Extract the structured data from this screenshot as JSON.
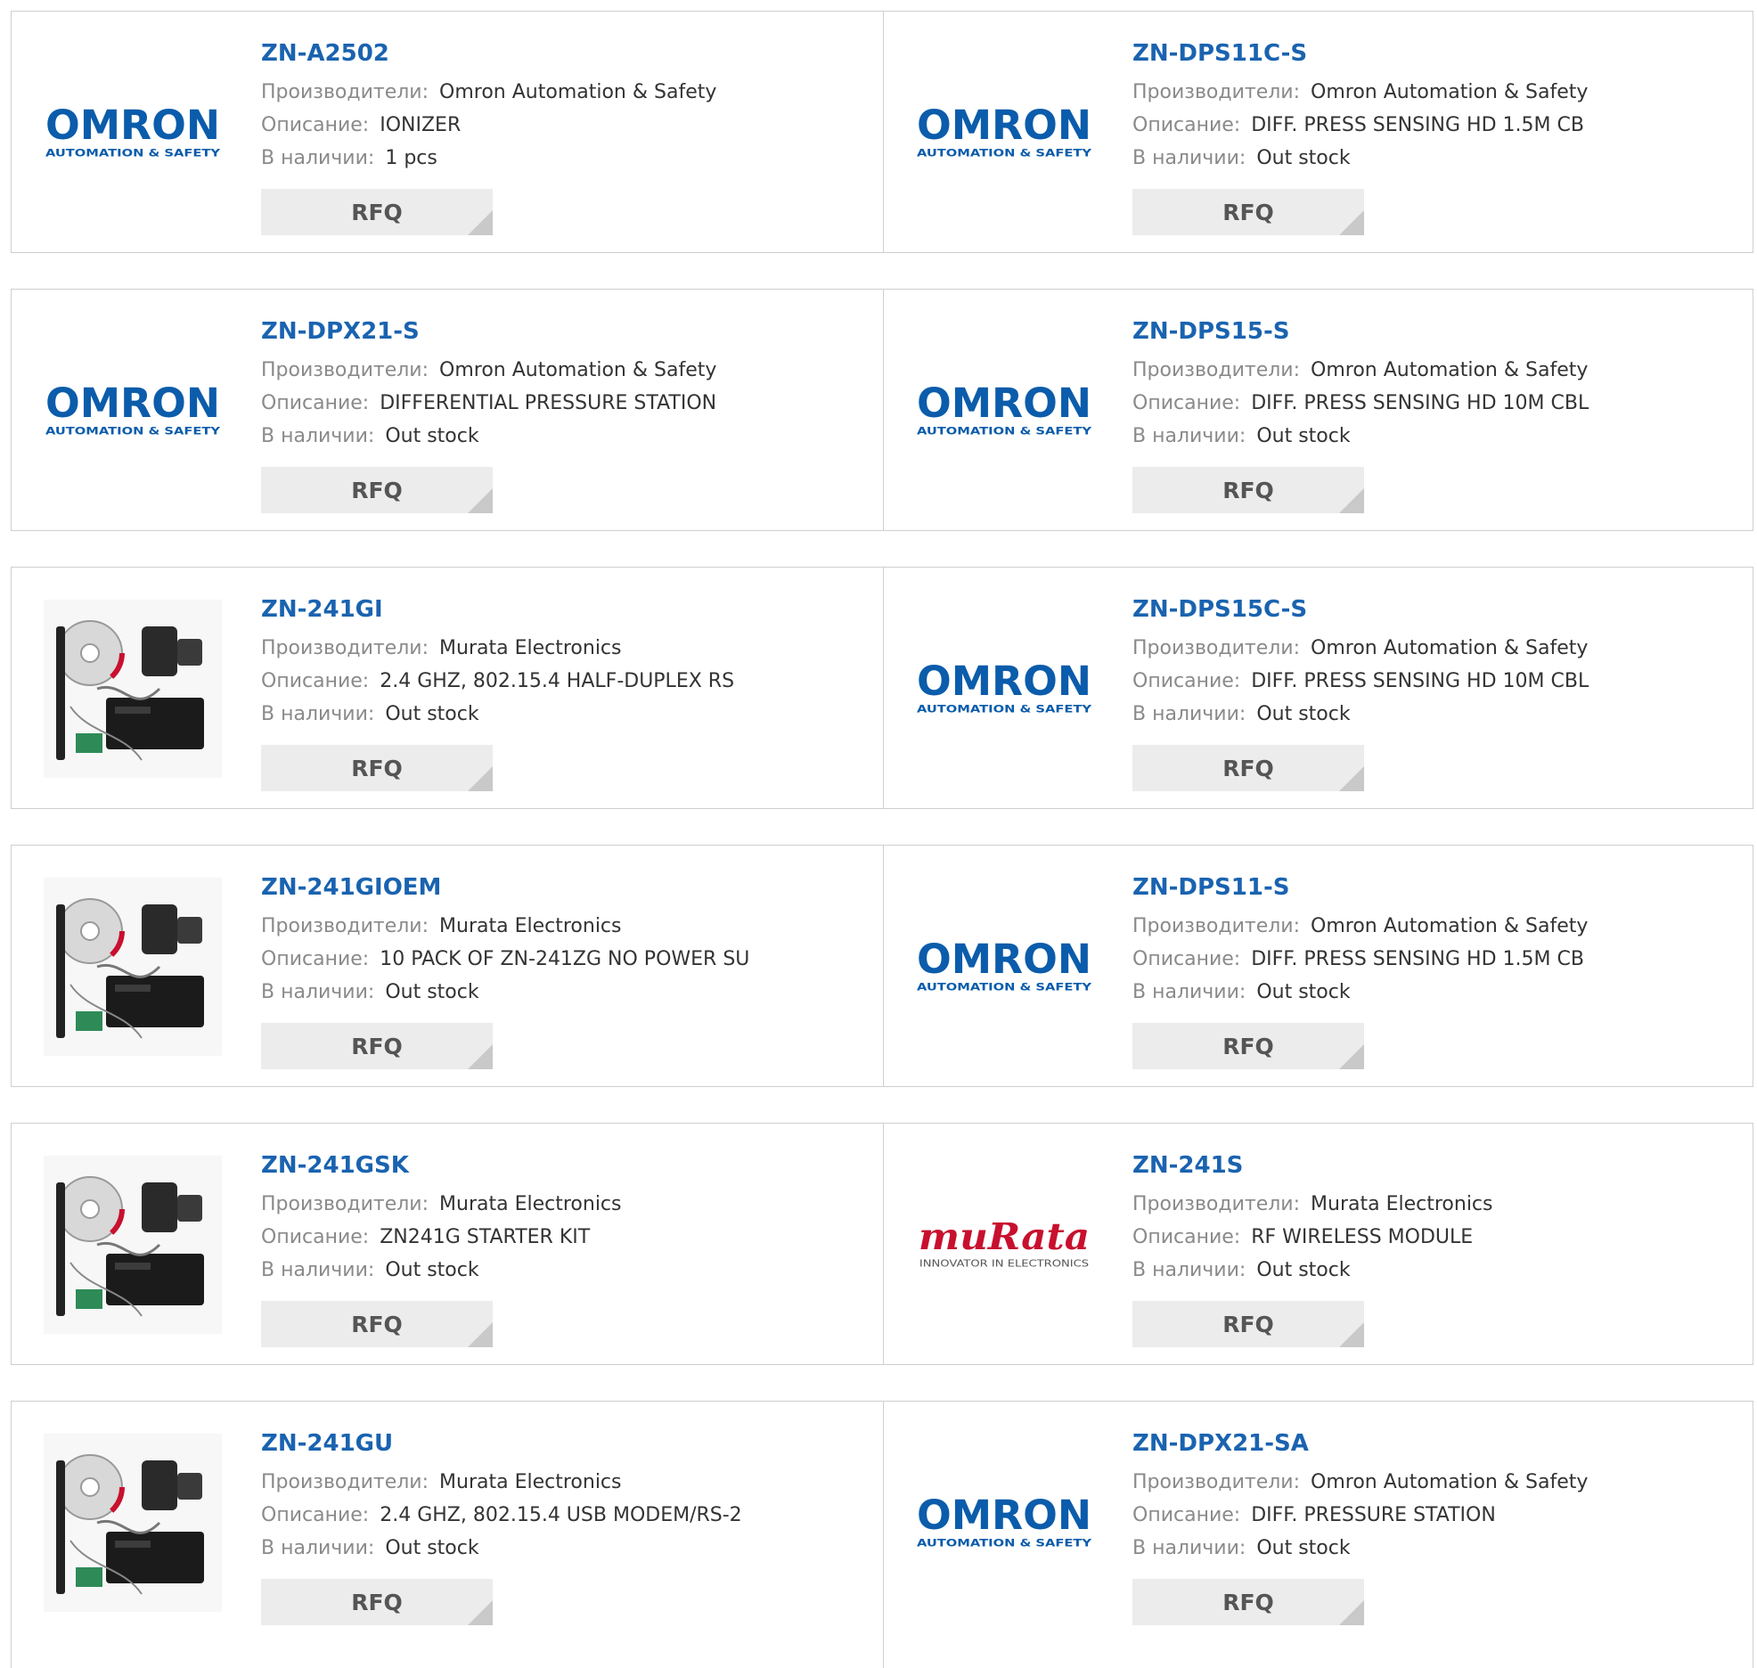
{
  "labels": {
    "manufacturer": "Производители:",
    "description": "Описание:",
    "stock": "В наличии:",
    "rfq": "RFQ"
  },
  "logos": {
    "omron_word": "OMRON",
    "omron_sub": "AUTOMATION & SAFETY",
    "murata_word": "muRata",
    "murata_sub": "INNOVATOR IN ELECTRONICS"
  },
  "colors": {
    "link": "#1a63b0",
    "omron_blue": "#0b5cab",
    "murata_red": "#c8102e"
  },
  "products": [
    {
      "part": "ZN-A2502",
      "manufacturer": "Omron Automation & Safety",
      "description": "IONIZER",
      "stock": "1 pcs",
      "image": "omron-logo"
    },
    {
      "part": "ZN-DPS11C-S",
      "manufacturer": "Omron Automation & Safety",
      "description": "DIFF. PRESS SENSING HD 1.5M CB",
      "stock": "Out stock",
      "image": "omron-logo"
    },
    {
      "part": "ZN-DPX21-S",
      "manufacturer": "Omron Automation & Safety",
      "description": "DIFFERENTIAL PRESSURE STATION",
      "stock": "Out stock",
      "image": "omron-logo"
    },
    {
      "part": "ZN-DPS15-S",
      "manufacturer": "Omron Automation & Safety",
      "description": "DIFF. PRESS SENSING HD 10M CBL",
      "stock": "Out stock",
      "image": "omron-logo"
    },
    {
      "part": "ZN-241GI",
      "manufacturer": "Murata Electronics",
      "description": "2.4 GHZ, 802.15.4 HALF-DUPLEX RS",
      "stock": "Out stock",
      "image": "product-photo-kit"
    },
    {
      "part": "ZN-DPS15C-S",
      "manufacturer": "Omron Automation & Safety",
      "description": "DIFF. PRESS SENSING HD 10M CBL",
      "stock": "Out stock",
      "image": "omron-logo"
    },
    {
      "part": "ZN-241GIOEM",
      "manufacturer": "Murata Electronics",
      "description": "10 PACK OF ZN-241ZG NO POWER SU",
      "stock": "Out stock",
      "image": "product-photo-box"
    },
    {
      "part": "ZN-DPS11-S",
      "manufacturer": "Omron Automation & Safety",
      "description": "DIFF. PRESS SENSING HD 1.5M CB",
      "stock": "Out stock",
      "image": "omron-logo"
    },
    {
      "part": "ZN-241GSK",
      "manufacturer": "Murata Electronics",
      "description": "ZN241G STARTER KIT",
      "stock": "Out stock",
      "image": "product-photo-starter-kit"
    },
    {
      "part": "ZN-241S",
      "manufacturer": "Murata Electronics",
      "description": "RF WIRELESS MODULE",
      "stock": "Out stock",
      "image": "murata-logo"
    },
    {
      "part": "ZN-241GU",
      "manufacturer": "Murata Electronics",
      "description": "2.4 GHZ, 802.15.4 USB MODEM/RS-2",
      "stock": "Out stock",
      "image": "product-photo-modem"
    },
    {
      "part": "ZN-DPX21-SA",
      "manufacturer": "Omron Automation & Safety",
      "description": "DIFF. PRESSURE STATION",
      "stock": "Out stock",
      "image": "omron-logo"
    }
  ]
}
